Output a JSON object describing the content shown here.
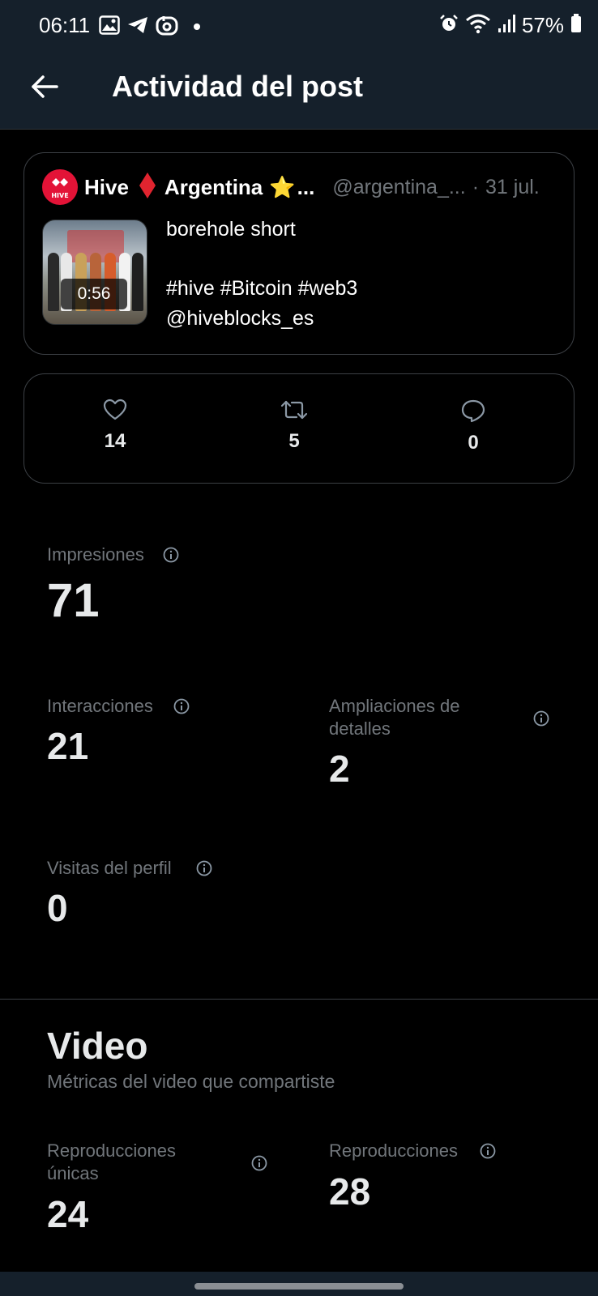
{
  "status_bar": {
    "time": "06:11",
    "battery": "57%",
    "left_icons": [
      "gallery-icon",
      "telegram-icon",
      "app-icon",
      "dot-icon"
    ],
    "right_icons": [
      "alarm-icon",
      "wifi-icon",
      "signal-icon",
      "battery-icon"
    ]
  },
  "header": {
    "title": "Actividad del post",
    "back_icon": "arrow-left-icon"
  },
  "post": {
    "author_part1": "Hive",
    "author_part2": "Argentina",
    "star": "⭐",
    "ellipsis": "...",
    "handle": "@argentina_...",
    "separator": "·",
    "date": "31 jul.",
    "video_duration": "0:56",
    "text_line1": "borehole short",
    "text_line2": "#hive #Bitcoin #web3",
    "text_line3": "@hiveblocks_es",
    "avatar_label": "HIVE"
  },
  "engagement": {
    "likes": "14",
    "reposts": "5",
    "replies": "0"
  },
  "metrics": {
    "impressions_label": "Impresiones",
    "impressions_value": "71",
    "interactions_label": "Interacciones",
    "interactions_value": "21",
    "detail_expands_label_1": "Ampliaciones de",
    "detail_expands_label_2": "detalles",
    "detail_expands_value": "2",
    "profile_visits_label": "Visitas del perfil",
    "profile_visits_value": "0"
  },
  "video": {
    "title": "Video",
    "subtitle": "Métricas del video que compartiste",
    "unique_plays_label_1": "Reproducciones",
    "unique_plays_label_2": "únicas",
    "unique_plays_value": "24",
    "plays_label": "Reproducciones",
    "plays_value": "28"
  },
  "colors": {
    "background": "#000000",
    "bars": "#15202b",
    "muted_text": "#71767b",
    "border": "#3c4045",
    "hive_red": "#e31337",
    "star_yellow": "#f4b400"
  }
}
